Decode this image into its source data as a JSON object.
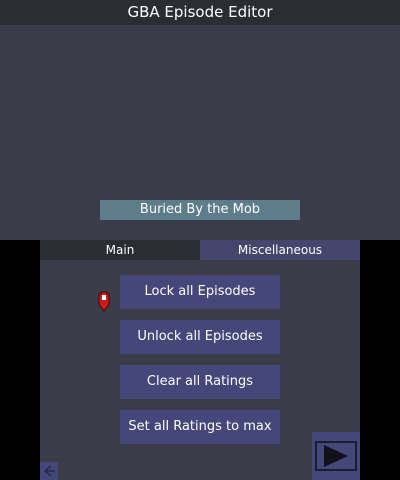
{
  "top": {
    "title": "GBA Episode Editor",
    "episode_name": "Buried By the Mob"
  },
  "tabs": [
    {
      "label": "Main",
      "active": true
    },
    {
      "label": "Miscellaneous",
      "active": false
    }
  ],
  "actions": {
    "lock_all": "Lock all Episodes",
    "unlock_all": "Unlock all Episodes",
    "clear_ratings": "Clear all Ratings",
    "max_ratings": "Set all Ratings to max"
  },
  "icons": {
    "cursor": "red-pointer-icon",
    "next": "play-arrow-icon",
    "back": "back-arrow-icon"
  },
  "colors": {
    "background": "#3a3d48",
    "header": "#2b2d35",
    "button": "#45477a",
    "banner": "#5e7d8a",
    "cursor": "#cc1a1a"
  }
}
